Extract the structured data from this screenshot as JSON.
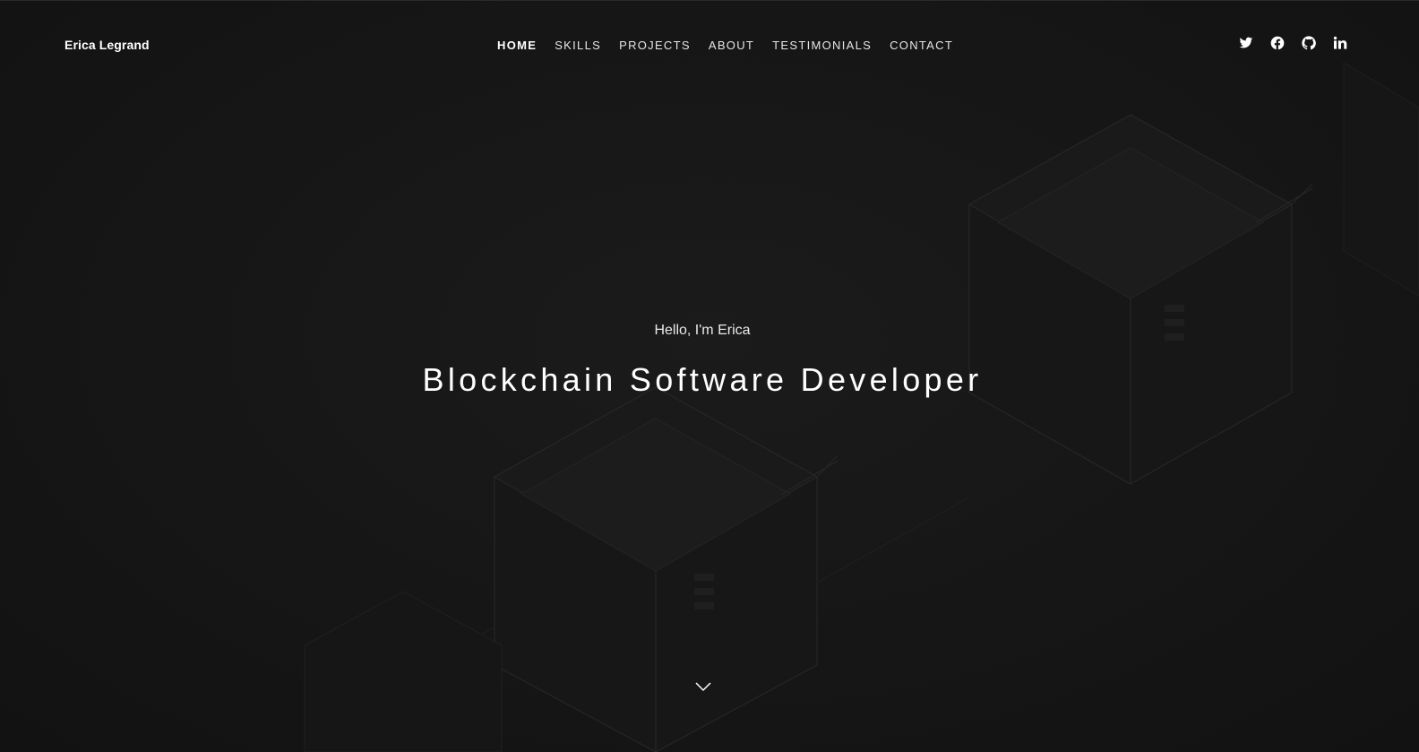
{
  "header": {
    "brand": "Erica Legrand",
    "nav": [
      {
        "label": "HOME",
        "active": true
      },
      {
        "label": "SKILLS",
        "active": false
      },
      {
        "label": "PROJECTS",
        "active": false
      },
      {
        "label": "ABOUT",
        "active": false
      },
      {
        "label": "TESTIMONIALS",
        "active": false
      },
      {
        "label": "CONTACT",
        "active": false
      }
    ],
    "social": [
      "twitter-icon",
      "facebook-icon",
      "github-icon",
      "linkedin-icon"
    ]
  },
  "hero": {
    "greeting": "Hello, I'm Erica",
    "title": "Blockchain Software Developer",
    "scroll_icon": "chevron-down-icon"
  },
  "colors": {
    "background": "#141414",
    "text": "#ffffff"
  }
}
